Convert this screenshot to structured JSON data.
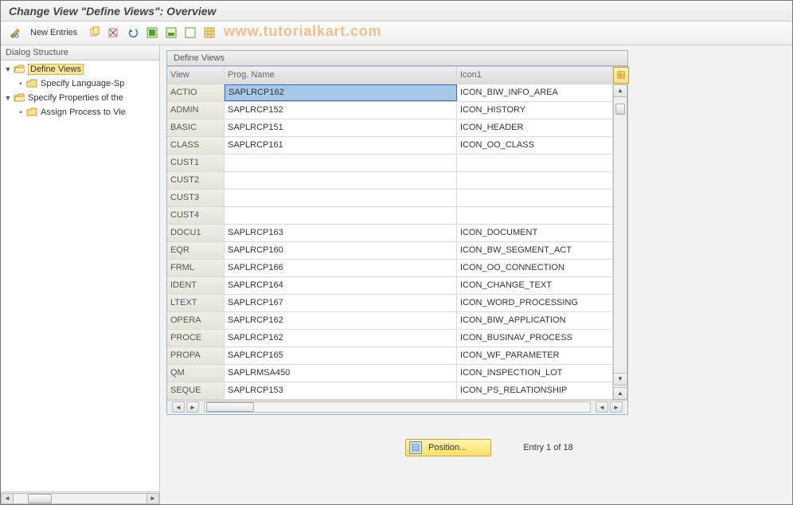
{
  "title": "Change View \"Define Views\": Overview",
  "watermark": "www.tutorialkart.com",
  "toolbar": {
    "new_entries": "New Entries"
  },
  "sidebar": {
    "header": "Dialog Structure",
    "nodes": [
      {
        "label": "Define Views",
        "selected": true,
        "expanded": true,
        "folder": "open"
      },
      {
        "label": "Specify Language-Sp",
        "indent": 1,
        "folder": "closed"
      },
      {
        "label": "Specify Properties of the",
        "expanded": true,
        "folder": "open"
      },
      {
        "label": "Assign Process to Vie",
        "indent": 1,
        "folder": "closed"
      }
    ]
  },
  "panel": {
    "title": "Define Views",
    "columns": {
      "c1": "View",
      "c2": "Prog. Name",
      "c3": "Icon1"
    },
    "rows": [
      {
        "view": "ACTIO",
        "prog": "SAPLRCP162",
        "icon": "ICON_BIW_INFO_AREA",
        "progSelected": true
      },
      {
        "view": "ADMIN",
        "prog": "SAPLRCP152",
        "icon": "ICON_HISTORY"
      },
      {
        "view": "BASIC",
        "prog": "SAPLRCP151",
        "icon": "ICON_HEADER"
      },
      {
        "view": "CLASS",
        "prog": "SAPLRCP161",
        "icon": "ICON_OO_CLASS"
      },
      {
        "view": "CUST1",
        "prog": "",
        "icon": ""
      },
      {
        "view": "CUST2",
        "prog": "",
        "icon": ""
      },
      {
        "view": "CUST3",
        "prog": "",
        "icon": ""
      },
      {
        "view": "CUST4",
        "prog": "",
        "icon": ""
      },
      {
        "view": "DOCU1",
        "prog": "SAPLRCP163",
        "icon": "ICON_DOCUMENT"
      },
      {
        "view": "EQR",
        "prog": "SAPLRCP160",
        "icon": "ICON_BW_SEGMENT_ACT"
      },
      {
        "view": "FRML",
        "prog": "SAPLRCP166",
        "icon": "ICON_OO_CONNECTION"
      },
      {
        "view": "IDENT",
        "prog": "SAPLRCP164",
        "icon": "ICON_CHANGE_TEXT"
      },
      {
        "view": "LTEXT",
        "prog": "SAPLRCP167",
        "icon": "ICON_WORD_PROCESSING"
      },
      {
        "view": "OPERA",
        "prog": "SAPLRCP162",
        "icon": "ICON_BIW_APPLICATION"
      },
      {
        "view": "PROCE",
        "prog": "SAPLRCP162",
        "icon": "ICON_BUSINAV_PROCESS"
      },
      {
        "view": "PROPA",
        "prog": "SAPLRCP165",
        "icon": "ICON_WF_PARAMETER"
      },
      {
        "view": "QM",
        "prog": "SAPLRMSA450",
        "icon": "ICON_INSPECTION_LOT"
      },
      {
        "view": "SEQUE",
        "prog": "SAPLRCP153",
        "icon": "ICON_PS_RELATIONSHIP"
      }
    ]
  },
  "footer": {
    "position_label": "Position...",
    "entry_text": "Entry 1 of 18"
  }
}
